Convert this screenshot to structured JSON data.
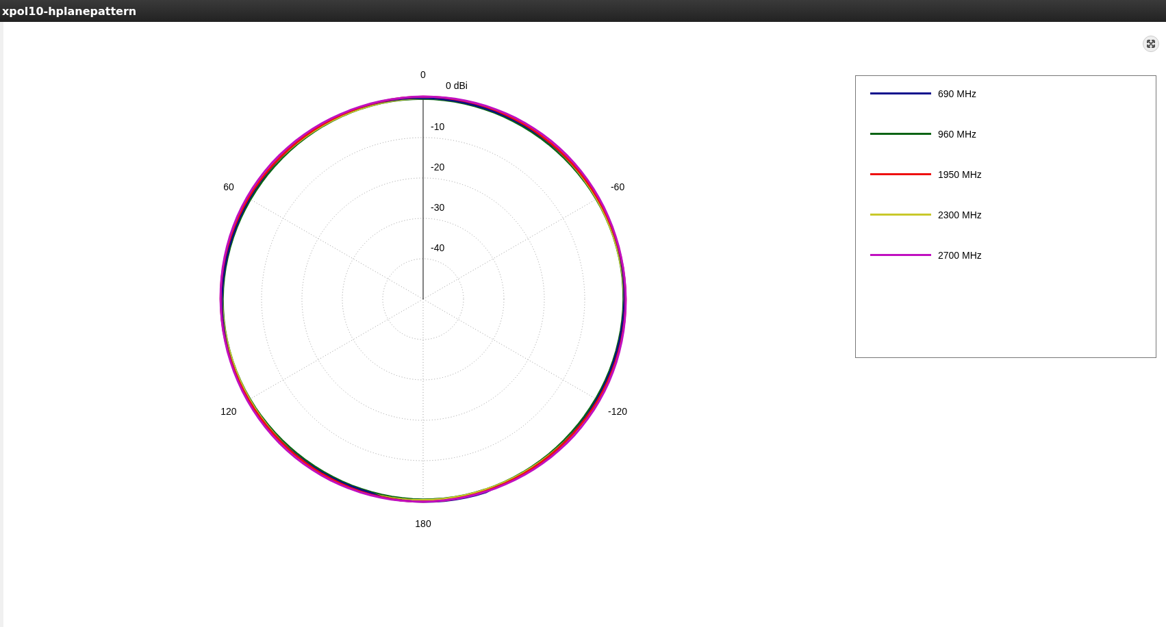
{
  "window": {
    "title": "xpol10-hplanepattern"
  },
  "chart": {
    "angle_labels": [
      "0",
      "60",
      "-60",
      "120",
      "-120",
      "180"
    ],
    "unit_label": "0 dBi",
    "ring_labels": [
      "-10",
      "-20",
      "-30",
      "-40"
    ]
  },
  "legend": [
    {
      "label": "690 MHz",
      "color": "#0a0a8c"
    },
    {
      "label": "960 MHz",
      "color": "#0a6414"
    },
    {
      "label": "1950 MHz",
      "color": "#ee1010"
    },
    {
      "label": "2300 MHz",
      "color": "#c8c82a"
    },
    {
      "label": "2700 MHz",
      "color": "#c010c0"
    }
  ]
}
